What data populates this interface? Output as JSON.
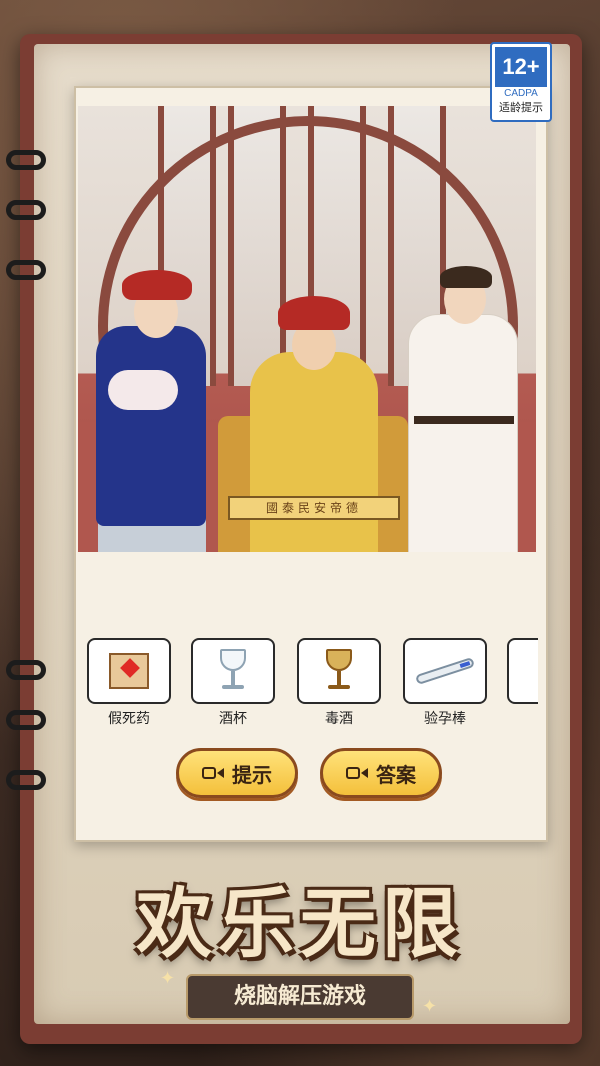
{
  "rating": {
    "age": "12+",
    "org": "CADPA",
    "tip": "适龄提示"
  },
  "scene": {
    "banner_text": "國泰民安帝德"
  },
  "items": [
    {
      "label": "假死药",
      "icon": "medicine-packet-icon"
    },
    {
      "label": "酒杯",
      "icon": "wine-glass-icon"
    },
    {
      "label": "毒酒",
      "icon": "poison-wine-icon"
    },
    {
      "label": "验孕棒",
      "icon": "pregnancy-test-icon"
    },
    {
      "label": "",
      "icon": "flower-icon"
    }
  ],
  "buttons": {
    "hint": "提示",
    "answer": "答案"
  },
  "title": "欢乐无限",
  "subtitle": "烧脑解压游戏",
  "colors": {
    "accent": "#f4c03b",
    "page": "#f6f0e4",
    "book": "#7b3d33"
  }
}
